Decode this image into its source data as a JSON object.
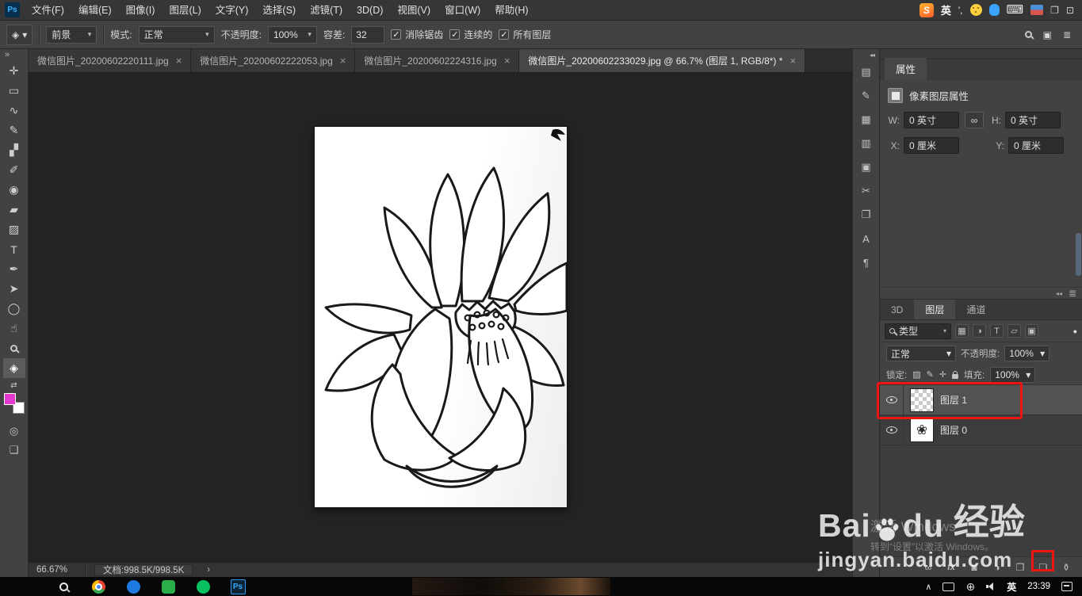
{
  "ui": {
    "caret": "▾",
    "close": "×",
    "keyboard": "⌨",
    "float_window": "❐",
    "dock_window": "⊡",
    "workspace_switcher": "▣",
    "panel_menu": "≣"
  },
  "menubar": {
    "logo": "Ps",
    "items": [
      "文件(F)",
      "编辑(E)",
      "图像(I)",
      "图层(L)",
      "文字(Y)",
      "选择(S)",
      "滤镜(T)",
      "3D(D)",
      "视图(V)",
      "窗口(W)",
      "帮助(H)"
    ],
    "ime": {
      "sogou": "S",
      "lang": "英",
      "mode": "',"
    }
  },
  "options": {
    "tool_icon": "◈",
    "fill_source": "前景",
    "mode_label": "模式:",
    "mode_value": "正常",
    "opacity_label": "不透明度:",
    "opacity_value": "100%",
    "tolerance_label": "容差:",
    "tolerance_value": "32",
    "checkbox_labels": [
      "消除锯齿",
      "连续的",
      "所有图层"
    ]
  },
  "tabs": [
    {
      "label": "微信图片_20200602220111.jpg"
    },
    {
      "label": "微信图片_20200602222053.jpg"
    },
    {
      "label": "微信图片_20200602224316.jpg"
    },
    {
      "label": "微信图片_20200602233029.jpg @ 66.7% (图层 1, RGB/8*) *"
    }
  ],
  "toolbar": {
    "expand": "»",
    "tools": [
      {
        "name": "move",
        "glyph": "✛"
      },
      {
        "name": "marquee",
        "glyph": "▭"
      },
      {
        "name": "lasso",
        "glyph": "∿"
      },
      {
        "name": "quick-selection",
        "glyph": "✎"
      },
      {
        "name": "crop",
        "glyph": "▞"
      },
      {
        "name": "brush",
        "glyph": "✐"
      },
      {
        "name": "clone-stamp",
        "glyph": "◉"
      },
      {
        "name": "eraser",
        "glyph": "▰"
      },
      {
        "name": "gradient",
        "glyph": "▨"
      },
      {
        "name": "type",
        "glyph": "T"
      },
      {
        "name": "pen",
        "glyph": "✒"
      },
      {
        "name": "path-selection",
        "glyph": "➤"
      },
      {
        "name": "ellipse",
        "glyph": "◯"
      },
      {
        "name": "hand",
        "glyph": "☝"
      },
      {
        "name": "zoom",
        "glyph": ""
      },
      {
        "name": "paint-bucket",
        "glyph": "◈"
      }
    ],
    "swap": "⇄",
    "foreground_color": "#e538cf",
    "background_color": "#ffffff",
    "quick_mask": "◎",
    "screen_mode": "❏"
  },
  "dock_strip": {
    "collapse": "◂◂",
    "icons": [
      {
        "name": "adjustments",
        "glyph": "▤"
      },
      {
        "name": "brush-settings",
        "glyph": "✎"
      },
      {
        "name": "gradients",
        "glyph": "▦"
      },
      {
        "name": "swatches",
        "glyph": "▥"
      },
      {
        "name": "libraries",
        "glyph": "▣"
      },
      {
        "name": "clone-source",
        "glyph": "✂"
      },
      {
        "name": "history",
        "glyph": "❐"
      },
      {
        "name": "character",
        "glyph": "A"
      },
      {
        "name": "paragraph",
        "glyph": "¶"
      }
    ]
  },
  "properties": {
    "title": "属性",
    "type_label": "像素图层属性",
    "w_label": "W:",
    "w_value": "0 英寸",
    "h_label": "H:",
    "h_value": "0 英寸",
    "x_label": "X:",
    "x_value": "0 厘米",
    "y_label": "Y:",
    "y_value": "0 厘米",
    "link": "∞",
    "collapse": "◂◂"
  },
  "layers": {
    "tabs": [
      "3D",
      "图层",
      "通道"
    ],
    "filter_label": "类型",
    "filter_icons": [
      "▦",
      "◑",
      "T",
      "▱",
      "▣"
    ],
    "filter_toggle": "●",
    "blend_mode": "正常",
    "opacity_label": "不透明度:",
    "opacity_value": "100%",
    "lock_label": "锁定:",
    "lock_icons": [
      "▨",
      "✎",
      "✛"
    ],
    "fill_label": "填充:",
    "fill_value": "100%",
    "rows": [
      {
        "name": "图层 1",
        "selected": true
      },
      {
        "name": "图层 0",
        "selected": false
      }
    ],
    "thumb_flower": "❀",
    "bottom_icons": {
      "link": "∞",
      "fx": "fx",
      "mask": "◙",
      "adjust": "◑",
      "group": "❐",
      "new_layer": "❏",
      "trash": "⚱"
    }
  },
  "statusbar": {
    "zoom": "66.67%",
    "doc_info": "文档:998.5K/998.5K",
    "chevron": "›"
  },
  "taskbar": {
    "ps": "Ps",
    "tray_expand": "∧",
    "globe": "⊕",
    "lang": "英",
    "time": "23:39"
  },
  "watermark": {
    "part1": "Bai",
    "part2": "du",
    "suffix": "经验",
    "url": "jingyan.baidu.com",
    "activate_line1": "激活 Windows",
    "activate_line2": "转到“设置”以激活 Windows。"
  },
  "annotations": {
    "color": "#ee1414"
  }
}
